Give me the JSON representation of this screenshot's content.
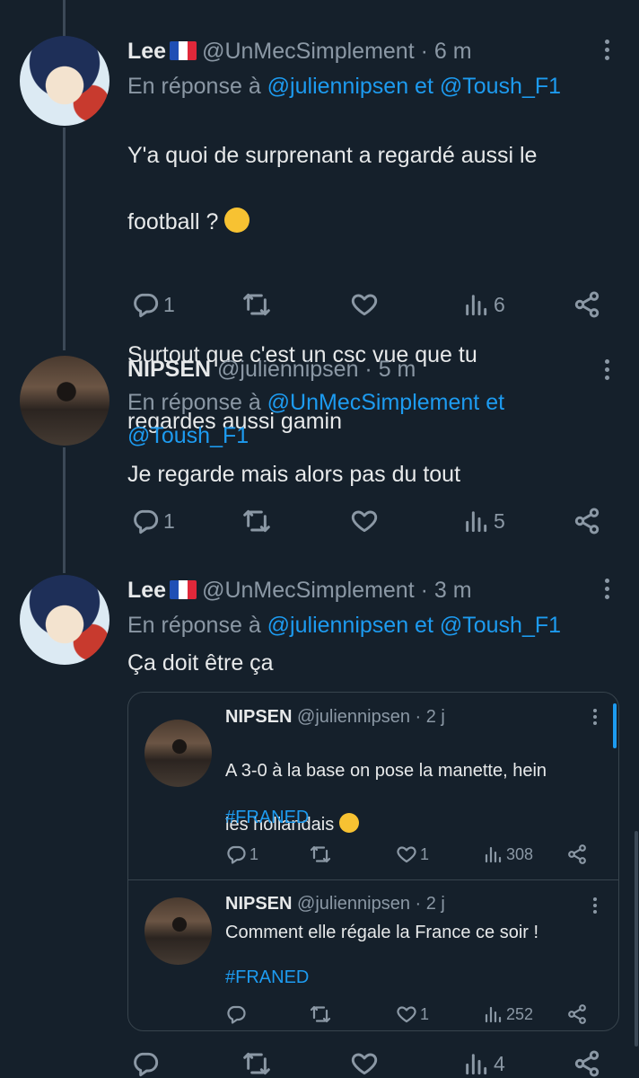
{
  "tweets": [
    {
      "display_name": "Lee",
      "flag": "FR",
      "handle": "@UnMecSimplement",
      "time": "· 6 m",
      "reply_prefix": "En réponse à",
      "reply_user1": "@juliennipsen",
      "reply_and": "et",
      "reply_user2": "@Toush_F1",
      "text_line1": "Y'a quoi de surprenant a regardé aussi le",
      "text_line2": "football ?",
      "text_line3": "Surtout que c'est un csc vue que tu",
      "text_line4": "regardes aussi gamin",
      "replies": "1",
      "retweets": "",
      "likes": "",
      "views": "6"
    },
    {
      "display_name": "NIPSEN",
      "handle": "@juliennipsen",
      "time": "· 5 m",
      "reply_prefix": "En réponse à",
      "reply_user1": "@UnMecSimplement",
      "reply_and": "et",
      "reply_user2": "@Toush_F1",
      "text": "Je regarde mais alors pas du tout",
      "replies": "1",
      "retweets": "",
      "likes": "",
      "views": "5"
    },
    {
      "display_name": "Lee",
      "flag": "FR",
      "handle": "@UnMecSimplement",
      "time": "· 3 m",
      "reply_prefix": "En réponse à",
      "reply_user1": "@juliennipsen",
      "reply_and": "et",
      "reply_user2": "@Toush_F1",
      "text": "Ça doit être ça",
      "replies": "",
      "retweets": "",
      "likes": "",
      "views": "4"
    }
  ],
  "quoted": [
    {
      "display_name": "NIPSEN",
      "handle": "@juliennipsen",
      "time": "· 2 j",
      "text_line1": "A 3-0 à la base on pose la manette, hein",
      "text_line2": "les hollandais",
      "hashtag": "#FRANED",
      "replies": "1",
      "likes": "1",
      "views": "308"
    },
    {
      "display_name": "NIPSEN",
      "handle": "@juliennipsen",
      "time": "· 2 j",
      "text": "Comment elle régale la France ce soir !",
      "hashtag": "#FRANED",
      "likes": "1",
      "views": "252"
    }
  ],
  "colors": {
    "background": "#15202b",
    "text": "#e7e9ea",
    "muted": "#8b98a5",
    "link": "#1d9bf0",
    "border": "#38444d"
  },
  "icons": [
    "reply-icon",
    "retweet-icon",
    "like-icon",
    "views-icon",
    "share-icon",
    "more-icon",
    "emoji-raised-eyebrow",
    "emoji-rolling-eyes"
  ]
}
